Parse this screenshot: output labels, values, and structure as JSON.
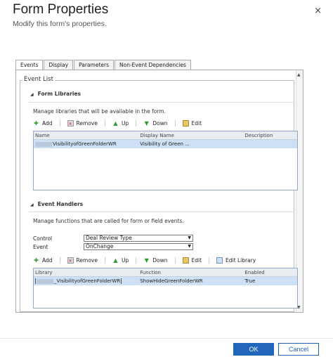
{
  "dialog": {
    "title": "Form Properties",
    "subtitle": "Modify this form's properties.",
    "close_glyph": "×"
  },
  "tabs": [
    {
      "label": "Events",
      "active": true
    },
    {
      "label": "Display",
      "active": false
    },
    {
      "label": "Parameters",
      "active": false
    },
    {
      "label": "Non-Event Dependencies",
      "active": false
    }
  ],
  "event_list": {
    "legend": "Event List",
    "form_libraries": {
      "heading": "Form Libraries",
      "description": "Manage libraries that will be available in the form.",
      "toolbar": {
        "add": "Add",
        "remove": "Remove",
        "up": "Up",
        "down": "Down",
        "edit": "Edit"
      },
      "columns": [
        "Name",
        "Display Name",
        "Description"
      ],
      "rows": [
        {
          "name": "VisibilityofGreenFolderWR",
          "display_name": "Visibility of Green ...",
          "description": ""
        }
      ]
    },
    "event_handlers": {
      "heading": "Event Handlers",
      "description": "Manage functions that are called for form or field events.",
      "control_label": "Control",
      "control_value": "Deal Review Type",
      "event_label": "Event",
      "event_value": "OnChange",
      "toolbar": {
        "add": "Add",
        "remove": "Remove",
        "up": "Up",
        "down": "Down",
        "edit": "Edit",
        "edit_library": "Edit Library"
      },
      "columns": [
        "Library",
        "Function",
        "Enabled"
      ],
      "rows": [
        {
          "library": "_VisibilityofGreenFolderWR",
          "function": "ShowHideGreenFolderWR",
          "enabled": "True"
        }
      ]
    }
  },
  "footer": {
    "ok_label": "OK",
    "cancel_label": "Cancel"
  },
  "colors": {
    "primary": "#2266bb",
    "selection": "#cde0f5"
  }
}
